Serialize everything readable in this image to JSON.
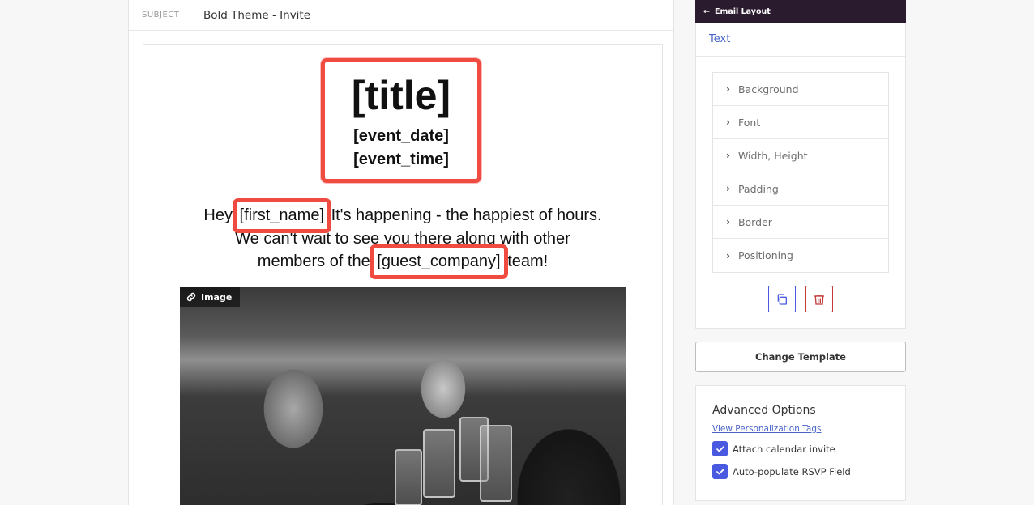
{
  "subject": {
    "label": "SUBJECT",
    "value": "Bold Theme - Invite"
  },
  "email": {
    "title": "[title]",
    "event_date": "[event_date]",
    "event_time": "[event_time]",
    "body": {
      "part1": "Hey",
      "tag1": "[first_name]",
      "part2": "It's happening - the happiest of hours.",
      "part3": "We can't wait to see you there along with other",
      "part4": "members of the",
      "tag2": "[guest_company]",
      "part5": "team!"
    },
    "image_badge": "Image"
  },
  "panel": {
    "header": "Email Layout",
    "tab": "Text",
    "properties": [
      "Background",
      "Font",
      "Width, Height",
      "Padding",
      "Border",
      "Positioning"
    ],
    "change_template": "Change Template",
    "advanced": {
      "title": "Advanced Options",
      "link": "View Personalization Tags",
      "options": [
        {
          "label": "Attach calendar invite",
          "checked": true
        },
        {
          "label": "Auto-populate RSVP Field",
          "checked": true
        }
      ]
    }
  },
  "colors": {
    "accent": "#4a5ae0",
    "highlight": "#f04b41",
    "header": "#2b1b2e",
    "danger": "#c63a3a"
  }
}
